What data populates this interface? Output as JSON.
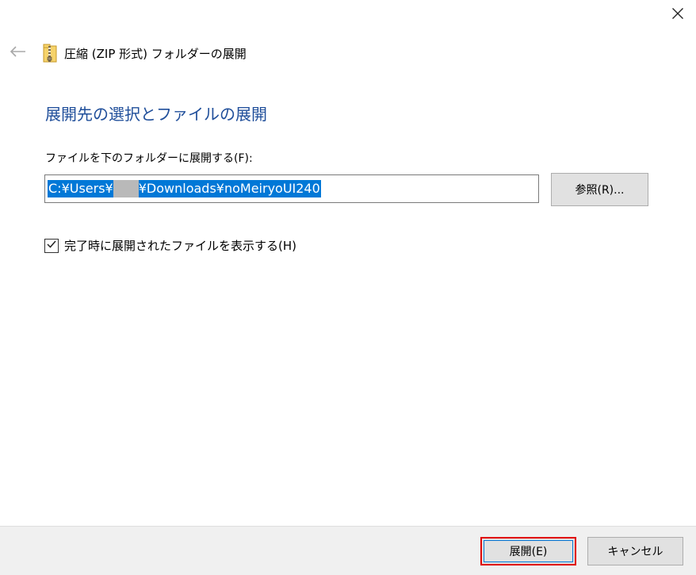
{
  "window": {
    "title": "圧縮 (ZIP 形式) フォルダーの展開"
  },
  "main": {
    "heading": "展開先の選択とファイルの展開",
    "destination_label": "ファイルを下のフォルダーに展開する(F):",
    "path_prefix": "C:¥Users¥",
    "path_suffix": "¥Downloads¥noMeiryoUI240",
    "browse_label": "参照(R)...",
    "show_files_label": "完了時に展開されたファイルを表示する(H)",
    "show_files_checked": true
  },
  "footer": {
    "extract_label": "展開(E)",
    "cancel_label": "キャンセル"
  },
  "colors": {
    "heading": "#1f4e9a",
    "selection": "#0078d7",
    "highlight_border": "#e00000",
    "footer_bg": "#f0f0f0"
  },
  "icons": {
    "close": "close-icon",
    "back": "back-arrow-icon",
    "zip": "zip-folder-icon",
    "check": "checkmark-icon"
  }
}
